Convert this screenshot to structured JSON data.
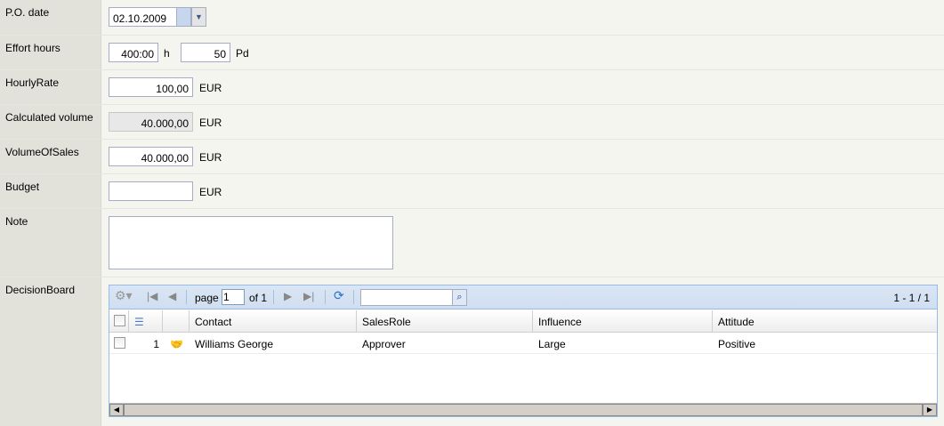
{
  "fields": {
    "po_date": {
      "label": "P.O. date",
      "value": "02.10.2009"
    },
    "effort": {
      "label": "Effort hours",
      "hours": "400:00",
      "hours_unit": "h",
      "pd": "50",
      "pd_unit": "Pd"
    },
    "hourly_rate": {
      "label": "HourlyRate",
      "value": "100,00",
      "unit": "EUR"
    },
    "calc_volume": {
      "label": "Calculated volume",
      "value": "40.000,00",
      "unit": "EUR"
    },
    "volume_sales": {
      "label": "VolumeOfSales",
      "value": "40.000,00",
      "unit": "EUR"
    },
    "budget": {
      "label": "Budget",
      "value": "",
      "unit": "EUR"
    },
    "note": {
      "label": "Note",
      "value": ""
    },
    "decision_board": {
      "label": "DecisionBoard"
    }
  },
  "grid": {
    "page_label": "page",
    "page_value": "1",
    "of_label": "of 1",
    "count": "1 - 1 / 1",
    "search_value": "",
    "columns": [
      "Contact",
      "SalesRole",
      "Influence",
      "Attitude"
    ],
    "rows": [
      {
        "num": "1",
        "contact": "Williams George",
        "role": "Approver",
        "influence": "Large",
        "attitude": "Positive"
      }
    ]
  }
}
